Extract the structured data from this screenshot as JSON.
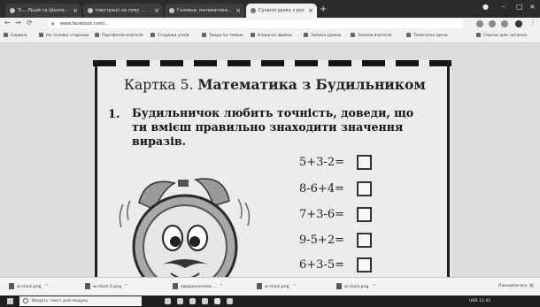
{
  "browser": {
    "tabs": [
      {
        "label": "Ті… Ліцей та Школа …",
        "active": false
      },
      {
        "label": "Ілюстрації на тему …",
        "active": false
      },
      {
        "label": "Головна: математика …",
        "active": false
      },
      {
        "label": "Сучасні урока з розвитку …",
        "active": true
      }
    ],
    "new_tab": "+",
    "url": "www.facebook.com/…",
    "bookmarks": [
      "Сервіси",
      "На головні сторінки",
      "Портфоліо вчителя",
      "Сторінка учнів",
      "Твори по темам",
      "Класичні файли",
      "Записи уроків",
      "Записи вчителя",
      "Тематичні вікна",
      "Список для читання"
    ]
  },
  "worksheet": {
    "title_normal": "Картка 5.",
    "title_bold": "Математика з Будильником",
    "question_number": "1.",
    "question_lines": [
      "Будильничок любить точність, доведи, що",
      "ти вмієш правильно знаходити значення",
      "виразів."
    ],
    "expressions": [
      "5+3-2=",
      "8-6+4=",
      "7+3-6=",
      "9-5+2=",
      "6+3-5="
    ]
  },
  "downloads": {
    "items": [
      "w-clock.png",
      "w-clock-2.png",
      "завдання-клас…",
      "w-clock.png",
      "w-clock.png"
    ],
    "show_all": "Показати все",
    "close": "×"
  },
  "taskbar": {
    "search_placeholder": "Введіть текст для пошуку",
    "tray_text": "UKR 11:42"
  }
}
